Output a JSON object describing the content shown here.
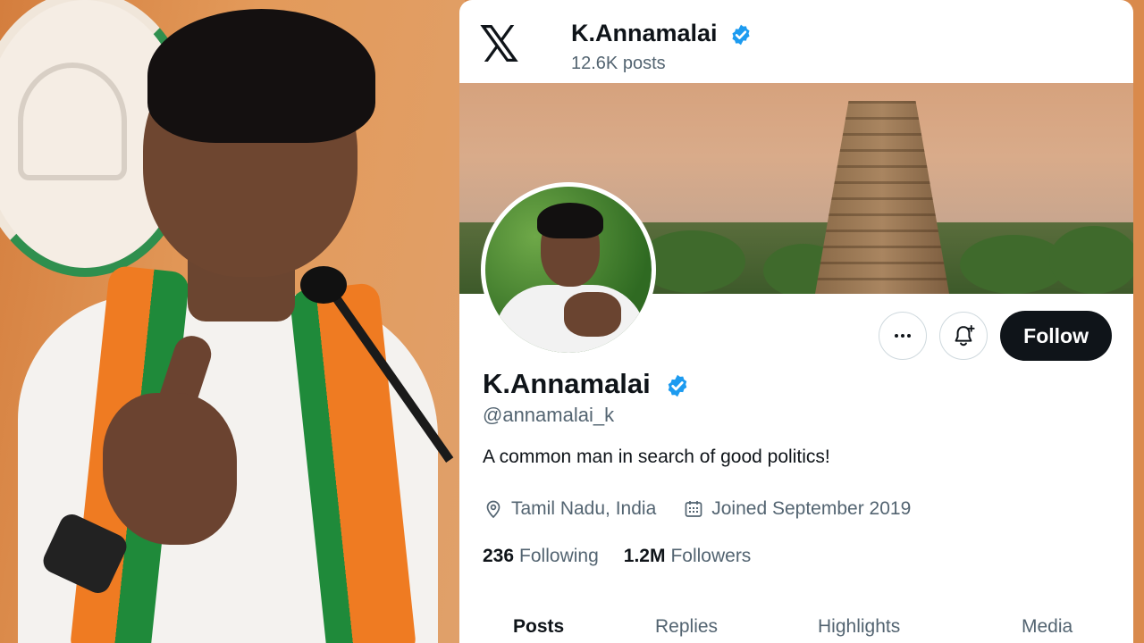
{
  "header": {
    "logo_icon": "x-logo-icon",
    "name": "K.Annamalai",
    "posts_count": "12.6K posts"
  },
  "profile": {
    "display_name": "K.Annamalai",
    "verified": true,
    "handle": "@annamalai_k",
    "bio": "A common man in search of good politics!",
    "location": "Tamil Nadu, India",
    "joined": "Joined September 2019",
    "following_count": "236",
    "following_label": "Following",
    "followers_count": "1.2M",
    "followers_label": "Followers"
  },
  "actions": {
    "more_icon": "more-horizontal-icon",
    "notify_icon": "bell-plus-icon",
    "follow_label": "Follow"
  },
  "tabs": [
    {
      "label": "Posts",
      "active": true
    },
    {
      "label": "Replies",
      "active": false
    },
    {
      "label": "Highlights",
      "active": false
    },
    {
      "label": "Media",
      "active": false
    }
  ],
  "colors": {
    "verified_blue": "#1d9bf0",
    "text_primary": "#0f1419",
    "text_secondary": "#536471",
    "follow_bg": "#0f1419"
  }
}
